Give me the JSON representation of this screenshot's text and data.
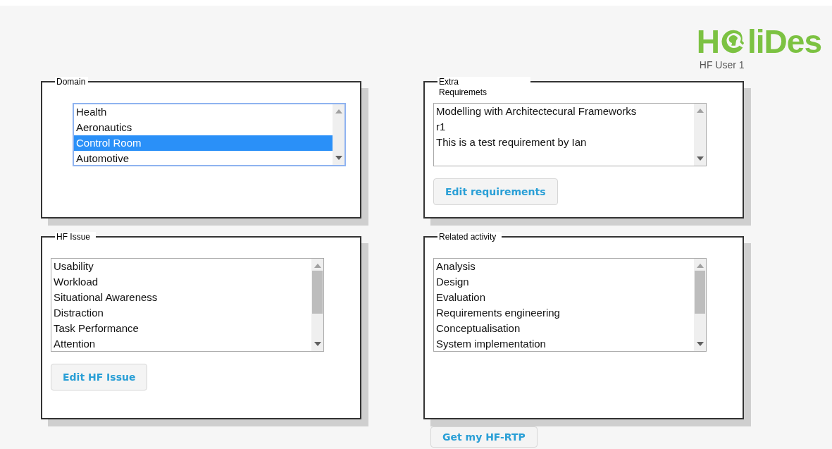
{
  "logo": {
    "parts": [
      "H",
      "liDes"
    ]
  },
  "user": "HF User 1",
  "panels": [
    {
      "legend": [
        "Domain"
      ],
      "items": [
        {
          "label": "Health",
          "selected": false
        },
        {
          "label": "Aeronautics",
          "selected": false
        },
        {
          "label": "Control Room",
          "selected": true
        },
        {
          "label": "Automotive",
          "selected": false
        }
      ],
      "focused": true,
      "scroll_thumb": false
    },
    {
      "legend": [
        "Extra",
        "Requiremets"
      ],
      "items": [
        {
          "label": "Modelling with Architectecural Frameworks",
          "selected": false
        },
        {
          "label": "r1",
          "selected": false
        },
        {
          "label": "This is a test requirement by Ian",
          "selected": false
        }
      ],
      "focused": false,
      "scroll_thumb": false,
      "button": "Edit requirements"
    },
    {
      "legend": [
        "HF Issue"
      ],
      "items": [
        {
          "label": "Usability",
          "selected": false
        },
        {
          "label": "Workload",
          "selected": false
        },
        {
          "label": "Situational Awareness",
          "selected": false
        },
        {
          "label": "Distraction",
          "selected": false
        },
        {
          "label": "Task Performance",
          "selected": false
        },
        {
          "label": "Attention",
          "selected": false
        }
      ],
      "focused": false,
      "scroll_thumb": true,
      "button": "Edit HF Issue"
    },
    {
      "legend": [
        "Related activity"
      ],
      "items": [
        {
          "label": "Analysis",
          "selected": false
        },
        {
          "label": "Design",
          "selected": false
        },
        {
          "label": "Evaluation",
          "selected": false
        },
        {
          "label": "Requirements engineering",
          "selected": false
        },
        {
          "label": "Conceptualisation",
          "selected": false
        },
        {
          "label": "System implementation",
          "selected": false
        }
      ],
      "focused": false,
      "scroll_thumb": true
    }
  ],
  "bottom_button": "Get my HF-RTP"
}
